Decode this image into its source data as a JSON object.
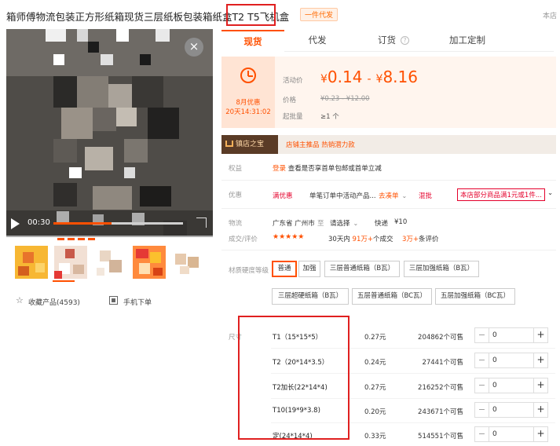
{
  "title": {
    "text": "箱师傅物流包装正方形纸箱现货三层纸板包装箱纸盒T2 T5飞机盒",
    "badge": "一件代发",
    "right": "本店"
  },
  "video": {
    "time": "00:30",
    "progress": 0.45,
    "close": "×"
  },
  "actions": {
    "favorite_label": "收藏产品(4593)",
    "mobile_label": "手机下单"
  },
  "tabs": [
    {
      "label": "现货",
      "active": true
    },
    {
      "label": "代发"
    },
    {
      "label": "订货",
      "help": "?"
    },
    {
      "label": "加工定制"
    }
  ],
  "promo": {
    "title": "8月优惠",
    "countdown": "20天14:31:02"
  },
  "price": {
    "label_activity": "活动价",
    "low": "0.14",
    "high": "8.16",
    "currency": "¥",
    "separator": "-",
    "label_price": "价格",
    "original": "¥0.23 - ¥12.00",
    "label_moq": "起批量",
    "moq": "≥1 个"
  },
  "store": {
    "badge": "镇店之宝",
    "desc": "店铺主推品  热销潜力款"
  },
  "benefit": {
    "label": "权益",
    "login": "登录",
    "text": "查看是否享首单包邮或首单立减"
  },
  "discount": {
    "label": "优惠",
    "coupon": "满优惠",
    "order_text": "单笔订单中活动产品...",
    "go_order": "去凑单",
    "mixed": "混批",
    "rule": "本店部分商品满1元或1件..."
  },
  "shipping": {
    "label": "物流",
    "from": "广东省 广州市",
    "to": "至",
    "select": "请选择",
    "express": "快递",
    "fee": "¥10"
  },
  "reviews": {
    "label": "成交/评价",
    "stars": "★★★★★",
    "deals_prefix": "30天内",
    "deals_count": "91万+",
    "deals_suffix": "个成交",
    "review_count": "3万+",
    "review_suffix": "条评价"
  },
  "material": {
    "label": "材质硬度等级",
    "options": [
      {
        "label": "普通",
        "selected": true
      },
      {
        "label": "加强"
      },
      {
        "label": "三层普通纸箱（B瓦）"
      },
      {
        "label": "三层加强纸箱（B瓦）"
      },
      {
        "label": "三层超硬纸箱（B瓦）"
      },
      {
        "label": "五层普通纸箱（BC瓦）"
      },
      {
        "label": "五层加强纸箱（BC瓦）"
      }
    ]
  },
  "sizes": {
    "label": "尺寸",
    "rows": [
      {
        "name": "T1（15*15*5）",
        "price": "0.27元",
        "stock": "204862个可售",
        "qty": "0"
      },
      {
        "name": "T2（20*14*3.5）",
        "price": "0.24元",
        "stock": "27441个可售",
        "qty": "0"
      },
      {
        "name": "T2加长(22*14*4)",
        "price": "0.27元",
        "stock": "216252个可售",
        "qty": "0"
      },
      {
        "name": "T10(19*9*3.8)",
        "price": "0.20元",
        "stock": "243671个可售",
        "qty": "0"
      },
      {
        "name": "定(24*14*4)",
        "price": "0.33元",
        "stock": "514551个可售",
        "qty": "0"
      }
    ],
    "minus": "−",
    "plus": "+"
  },
  "colors": {
    "accent": "#ff5000",
    "highlight": "#e02020",
    "price_bg": "#fff5ee"
  }
}
